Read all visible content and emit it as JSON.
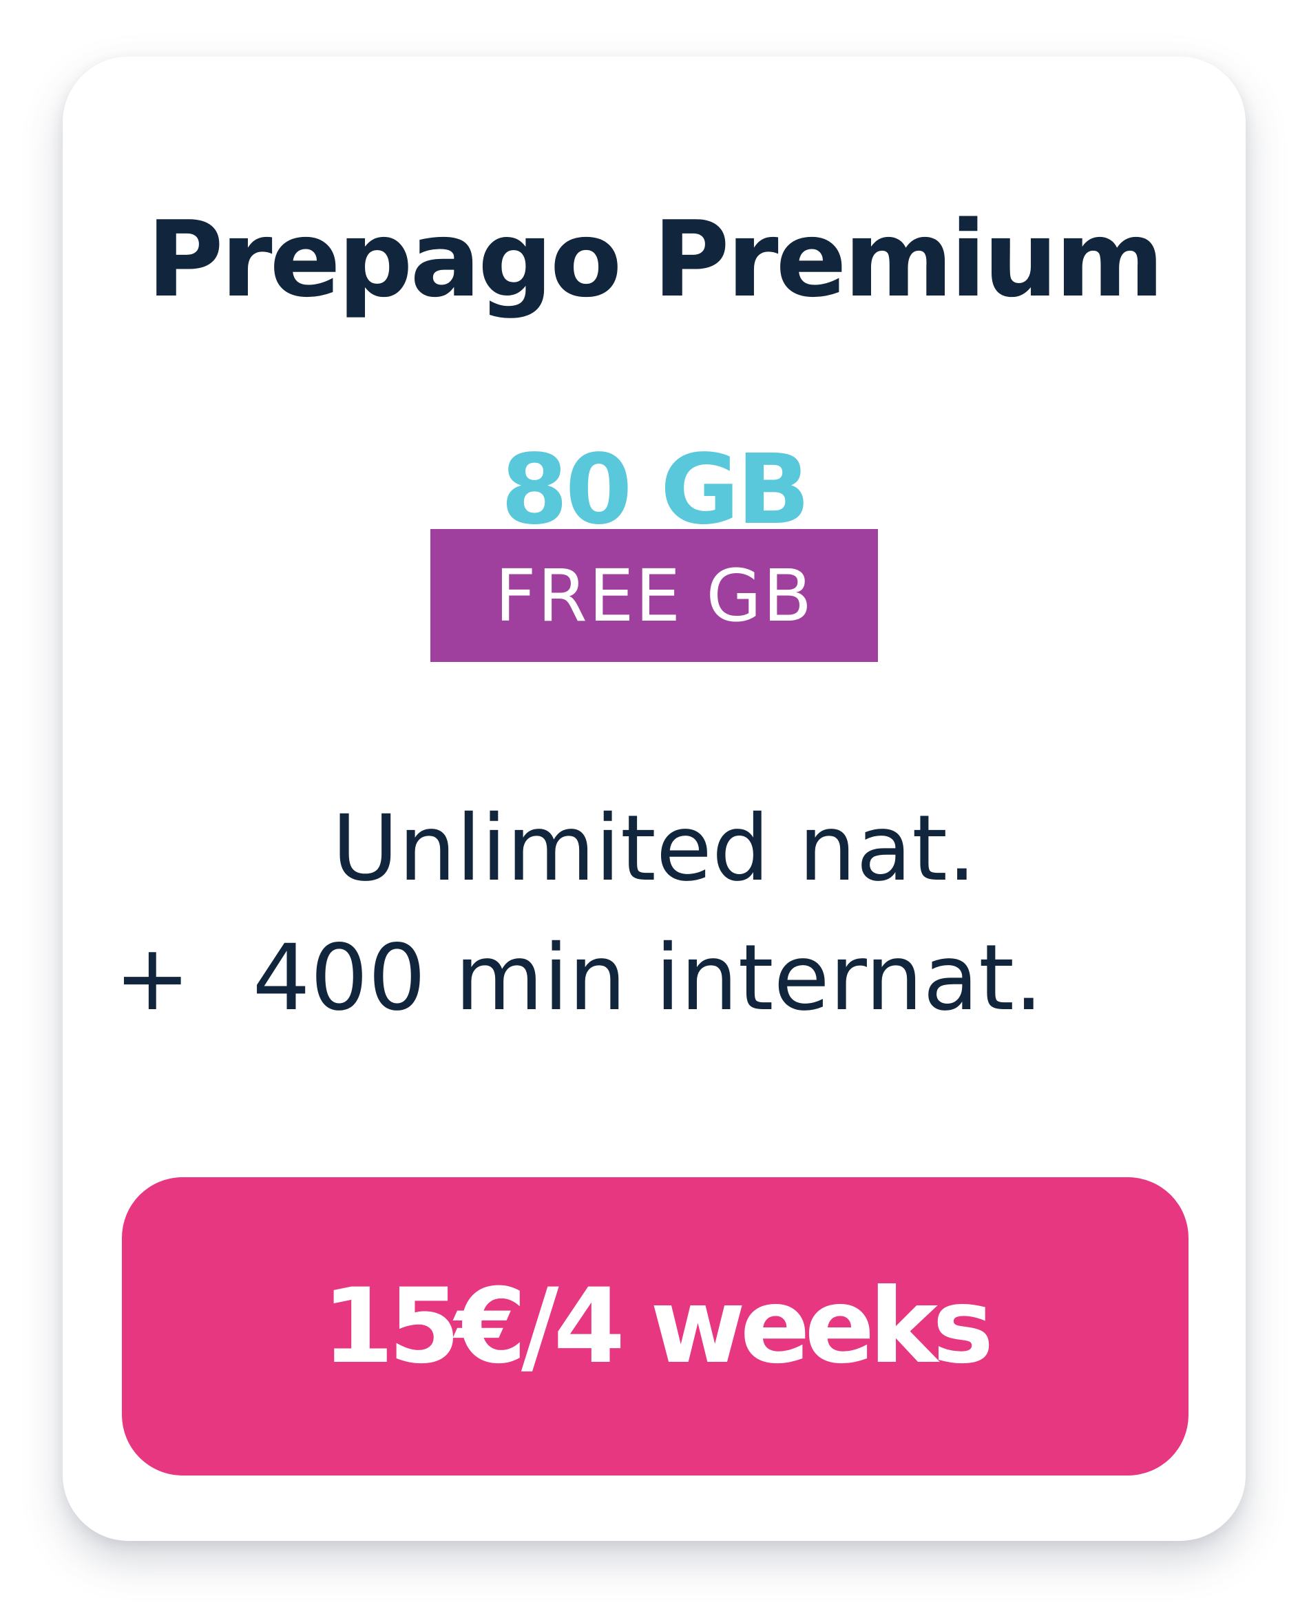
{
  "card": {
    "title": "Prepago Premium",
    "data_amount": "80 GB",
    "badge": "FREE GB",
    "calls_line1": "Unlimited nat.",
    "calls_plus": "+",
    "calls_line2": "400 min internat.",
    "price_button": "15€/4 weeks"
  },
  "colors": {
    "title": "#11263c",
    "data_amount": "#58c8da",
    "badge_bg": "#a0409e",
    "price_button_bg": "#e63780",
    "card_bg": "#ffffff"
  }
}
